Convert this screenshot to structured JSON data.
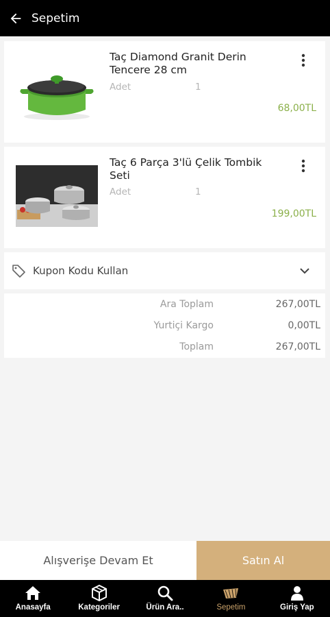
{
  "header": {
    "title": "Sepetim"
  },
  "cart": {
    "items": [
      {
        "name": "Taç Diamond Granit Derin Tencere 28 cm",
        "qty_label": "Adet",
        "qty": "1",
        "price": "68,00TL"
      },
      {
        "name": "Taç 6 Parça 3'lü Çelik Tombik Seti",
        "qty_label": "Adet",
        "qty": "1",
        "price": "199,00TL"
      }
    ],
    "coupon_label": "Kupon Kodu Kullan"
  },
  "summary": {
    "subtotal_label": "Ara Toplam",
    "subtotal": "267,00TL",
    "shipping_label": "Yurtiçi Kargo",
    "shipping": "0,00TL",
    "total_label": "Toplam",
    "total": "267,00TL"
  },
  "actions": {
    "continue_label": "Alışverişe Devam Et",
    "buy_label": "Satın Al"
  },
  "nav": {
    "items": [
      {
        "label": "Anasayfa",
        "icon": "home-icon"
      },
      {
        "label": "Kategoriler",
        "icon": "categories-icon"
      },
      {
        "label": "Ürün Ara..",
        "icon": "search-icon"
      },
      {
        "label": "Sepetim",
        "icon": "cart-icon",
        "active": true
      },
      {
        "label": "Giriş Yap",
        "icon": "user-icon"
      }
    ]
  },
  "colors": {
    "accent": "#d4b07c",
    "price": "#8bb04a",
    "active_nav": "#c9a16a"
  }
}
